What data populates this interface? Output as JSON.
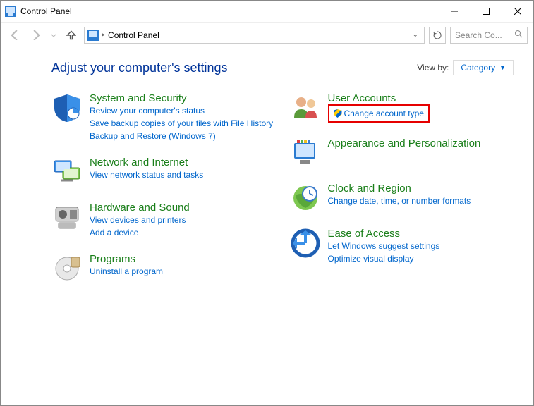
{
  "window": {
    "title": "Control Panel"
  },
  "address": {
    "crumb": "Control Panel"
  },
  "search": {
    "placeholder": "Search Co..."
  },
  "page": {
    "heading": "Adjust your computer's settings",
    "viewby_label": "View by:",
    "viewby_value": "Category"
  },
  "left_categories": [
    {
      "title": "System and Security",
      "links": [
        "Review your computer's status",
        "Save backup copies of your files with File History",
        "Backup and Restore (Windows 7)"
      ]
    },
    {
      "title": "Network and Internet",
      "links": [
        "View network status and tasks"
      ]
    },
    {
      "title": "Hardware and Sound",
      "links": [
        "View devices and printers",
        "Add a device"
      ]
    },
    {
      "title": "Programs",
      "links": [
        "Uninstall a program"
      ]
    }
  ],
  "right_categories": [
    {
      "title": "User Accounts",
      "links": [
        "Change account type"
      ]
    },
    {
      "title": "Appearance and Personalization",
      "links": []
    },
    {
      "title": "Clock and Region",
      "links": [
        "Change date, time, or number formats"
      ]
    },
    {
      "title": "Ease of Access",
      "links": [
        "Let Windows suggest settings",
        "Optimize visual display"
      ]
    }
  ]
}
